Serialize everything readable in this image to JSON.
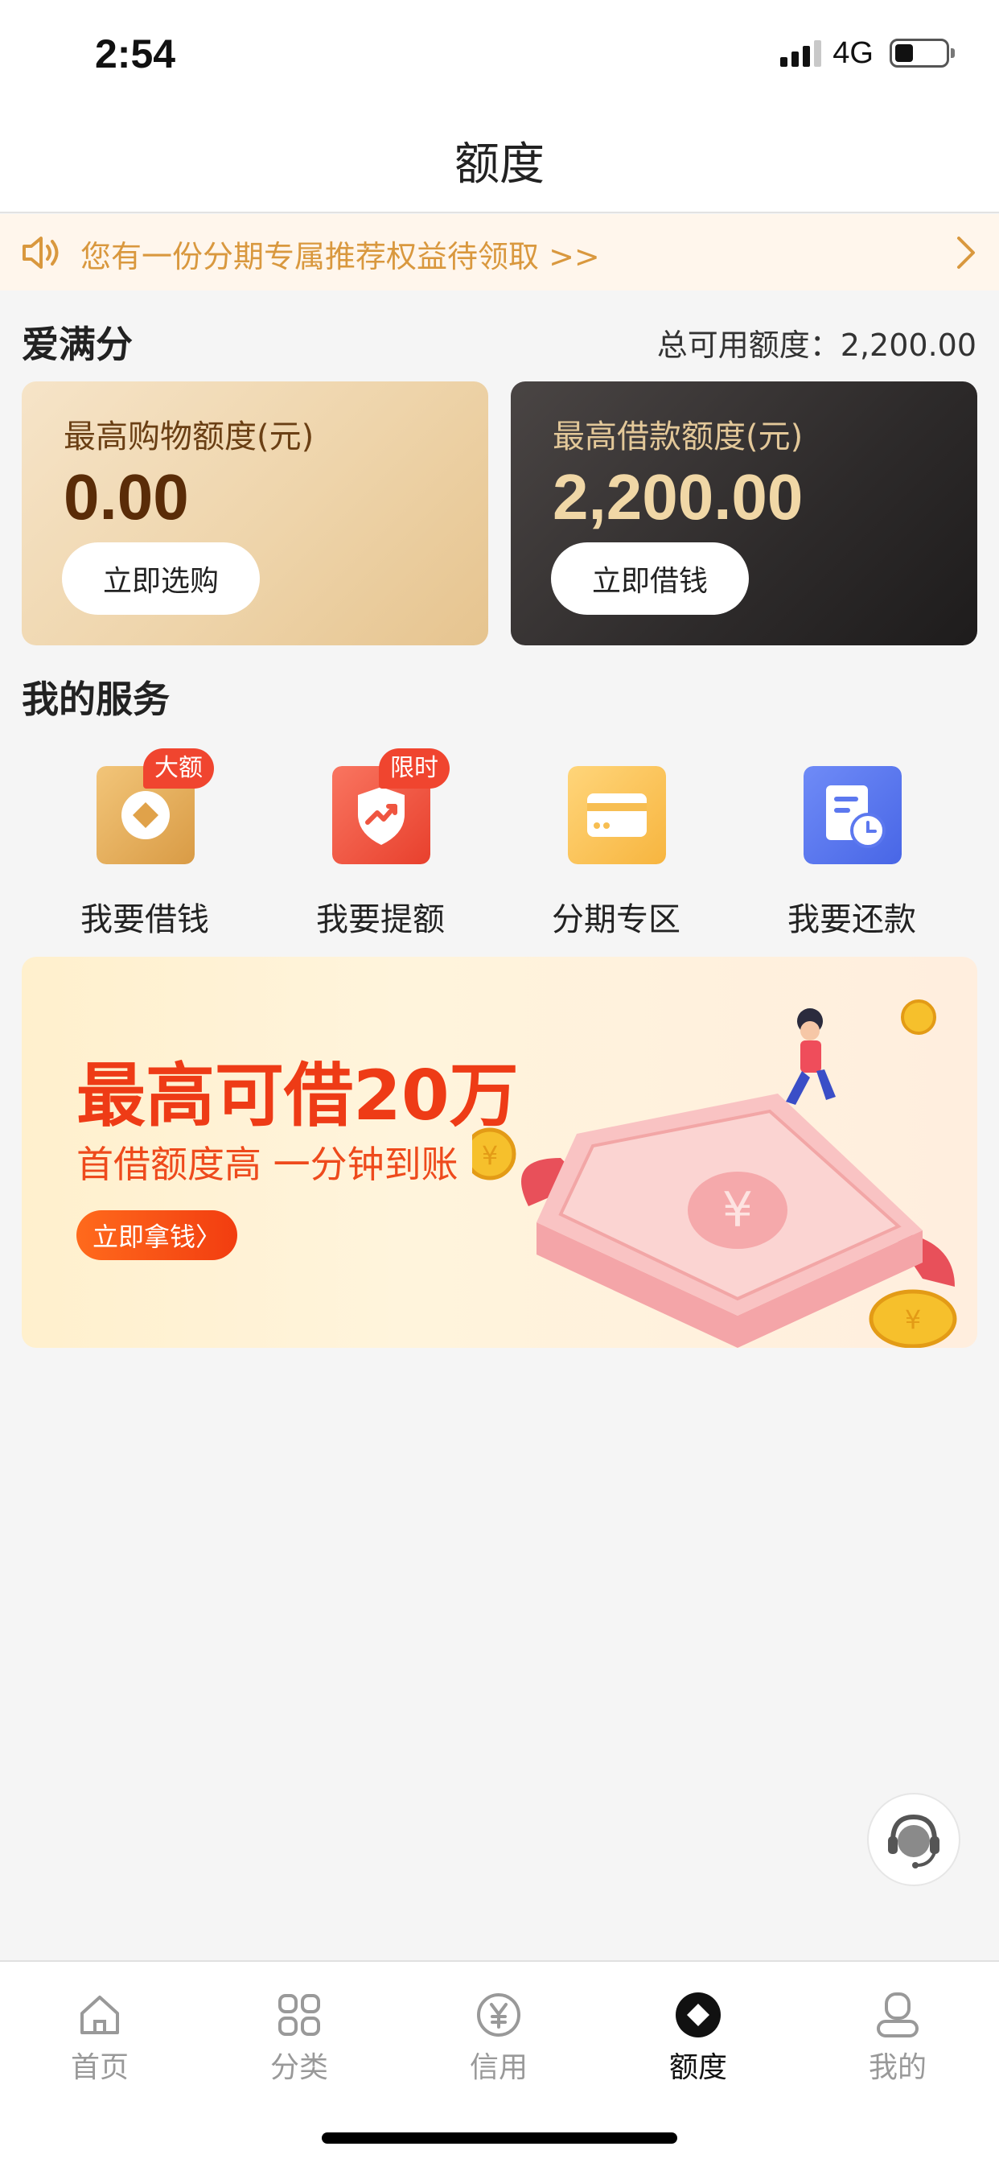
{
  "status": {
    "time": "2:54",
    "network": "4G"
  },
  "header": {
    "title": "额度"
  },
  "notice": {
    "text": "您有一份分期专属推荐权益待领取 >>"
  },
  "credit": {
    "section_title": "爱满分",
    "total_label": "总可用额度：",
    "total_value": "2,200.00",
    "cards": [
      {
        "label": "最高购物额度(元)",
        "value": "0.00",
        "button": "立即选购"
      },
      {
        "label": "最高借款额度(元)",
        "value": "2,200.00",
        "button": "立即借钱"
      }
    ]
  },
  "services": {
    "title": "我的服务",
    "items": [
      {
        "label": "我要借钱",
        "badge": "大额",
        "icon": "borrow-icon"
      },
      {
        "label": "我要提额",
        "badge": "限时",
        "icon": "shield-up-icon"
      },
      {
        "label": "分期专区",
        "icon": "card-icon"
      },
      {
        "label": "我要还款",
        "icon": "repay-clock-icon"
      }
    ]
  },
  "banner": {
    "title": "最高可借20万",
    "subtitle": "首借额度高  一分钟到账",
    "button": "立即拿钱〉"
  },
  "tabs": [
    {
      "label": "首页",
      "icon": "home-icon",
      "active": false
    },
    {
      "label": "分类",
      "icon": "grid-icon",
      "active": false
    },
    {
      "label": "信用",
      "icon": "yen-icon",
      "active": false
    },
    {
      "label": "额度",
      "icon": "quota-icon",
      "active": true
    },
    {
      "label": "我的",
      "icon": "profile-icon",
      "active": false
    }
  ],
  "colors": {
    "accent_orange": "#d9983e",
    "banner_red": "#ee3b16",
    "badge_red": "#f0452f",
    "dark_card": "#2d2a2a",
    "gold_card": "#eed4aa"
  }
}
